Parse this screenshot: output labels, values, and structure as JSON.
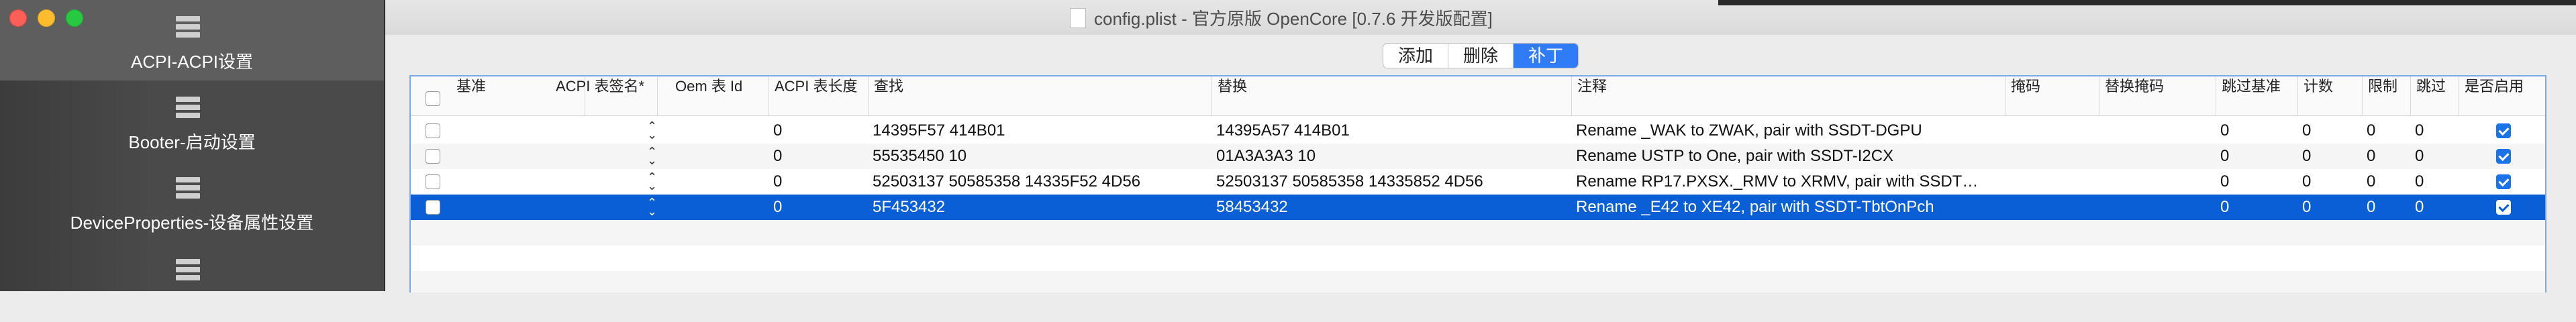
{
  "window": {
    "title": "config.plist - 官方原版 OpenCore [0.7.6 开发版配置]"
  },
  "sidebar": {
    "items": [
      {
        "label": "ACPI-ACPI设置",
        "icon": "list-icon"
      },
      {
        "label": "Booter-启动设置",
        "icon": "list-icon"
      },
      {
        "label": "DeviceProperties-设备属性设置",
        "icon": "list-icon"
      },
      {
        "label": "",
        "icon": "list-icon"
      }
    ]
  },
  "segments": {
    "add": "添加",
    "delete": "删除",
    "patch": "补丁"
  },
  "table": {
    "columns": [
      "基准",
      "ACPI 表签名*",
      "Oem 表 Id",
      "ACPI 表长度",
      "查找",
      "替换",
      "注释",
      "掩码",
      "替换掩码",
      "跳过基准",
      "计数",
      "限制",
      "跳过",
      "是否启用"
    ],
    "rows": [
      {
        "base": "",
        "sig": "",
        "oem": "",
        "len": "0",
        "find": "14395F57 414B01",
        "replace": "14395A57 414B01",
        "comment": "Rename _WAK to ZWAK, pair with SSDT-DGPU",
        "mask": "",
        "replace_mask": "",
        "skip_base": "0",
        "count": "0",
        "limit": "0",
        "skip": "0",
        "enabled": true
      },
      {
        "base": "",
        "sig": "",
        "oem": "",
        "len": "0",
        "find": "55535450 10",
        "replace": "01A3A3A3 10",
        "comment": "Rename USTP to One, pair with SSDT-I2CX",
        "mask": "",
        "replace_mask": "",
        "skip_base": "0",
        "count": "0",
        "limit": "0",
        "skip": "0",
        "enabled": true
      },
      {
        "base": "",
        "sig": "",
        "oem": "",
        "len": "0",
        "find": "52503137 50585358 14335F52 4D56",
        "replace": "52503137 50585358 14335852 4D56",
        "comment": "Rename RP17.PXSX._RMV to XRMV, pair with SSDT…",
        "mask": "",
        "replace_mask": "",
        "skip_base": "0",
        "count": "0",
        "limit": "0",
        "skip": "0",
        "enabled": true
      },
      {
        "base": "",
        "sig": "",
        "oem": "",
        "len": "0",
        "find": "5F453432",
        "replace": "58453432",
        "comment": "Rename _E42 to XE42, pair with SSDT-TbtOnPch",
        "mask": "",
        "replace_mask": "",
        "skip_base": "0",
        "count": "0",
        "limit": "0",
        "skip": "0",
        "enabled": true
      }
    ]
  },
  "colors": {
    "selection": "#0a5fd6",
    "accent": "#2f7cf6",
    "sidebar": "#4a4a4a"
  }
}
